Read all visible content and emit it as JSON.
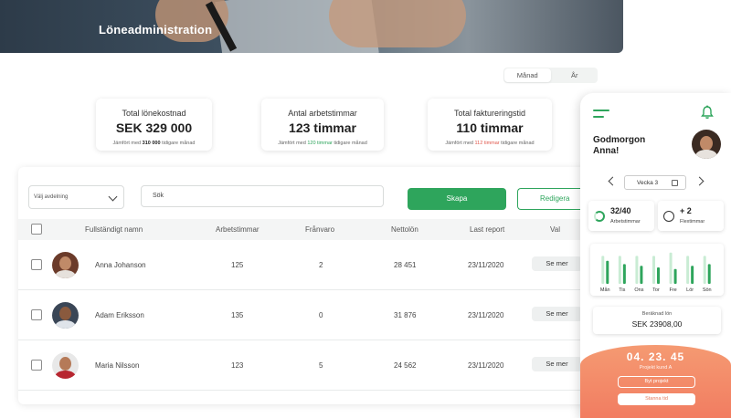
{
  "header": {
    "title": "Löneadministration"
  },
  "period_toggle": {
    "options": [
      "Månad",
      "År"
    ],
    "selected": "Månad"
  },
  "stats": [
    {
      "label": "Total lönekostnad",
      "value": "SEK 329 000",
      "cmp_prefix": "Jämfört med",
      "cmp_value": "310 000",
      "cmp_suffix": "tidigare månad",
      "cmp_color": "dark"
    },
    {
      "label": "Antal arbetstimmar",
      "value": "123 timmar",
      "cmp_prefix": "Jämfört med",
      "cmp_value": "120 timmar",
      "cmp_suffix": "tidigare månad",
      "cmp_color": "green"
    },
    {
      "label": "Total faktureringstid",
      "value": "110 timmar",
      "cmp_prefix": "Jämfört med",
      "cmp_value": "112 timmar",
      "cmp_suffix": "tidigare månad",
      "cmp_color": "red"
    }
  ],
  "toolbar": {
    "department_placeholder": "Välj avdelning",
    "search_placeholder": "Sök",
    "create_label": "Skapa",
    "edit_label": "Redigera"
  },
  "table": {
    "headers": [
      "Fullständigt namn",
      "Arbetstimmar",
      "Frånvaro",
      "Nettolön",
      "Last report",
      "Val"
    ],
    "rows": [
      {
        "name": "Anna Johanson",
        "hours": "125",
        "absence": "2",
        "net": "28 451",
        "report": "23/11/2020",
        "action": "Se mer"
      },
      {
        "name": "Adam Eriksson",
        "hours": "135",
        "absence": "0",
        "net": "31 876",
        "report": "23/11/2020",
        "action": "Se mer"
      },
      {
        "name": "Maria Nilsson",
        "hours": "123",
        "absence": "5",
        "net": "24 562",
        "report": "23/11/2020",
        "action": "Se mer"
      }
    ]
  },
  "phone": {
    "greeting_line1": "Godmorgon",
    "greeting_line2": "Anna!",
    "week_label": "Vecka 3",
    "hours_value": "32/40",
    "hours_label": "Arbetstimmar",
    "flex_value": "+ 2",
    "flex_label": "Flextimmar",
    "chart_data": {
      "type": "bar",
      "categories": [
        "Mån",
        "Tis",
        "Ons",
        "Tor",
        "Fre",
        "Lör",
        "Sön"
      ],
      "series": [
        {
          "values": [
            0.85,
            0.85,
            0.85,
            0.85,
            0.95,
            0.85,
            0.85
          ]
        },
        {
          "values": [
            0.7,
            0.6,
            0.55,
            0.5,
            0.45,
            0.55,
            0.6
          ]
        }
      ],
      "colors": [
        "#c9ecd4",
        "#2ea55c"
      ]
    },
    "salary_label": "Beräknad lön",
    "salary_value": "SEK 23908,00",
    "timer": "04. 23. 45",
    "project": "Projekt kund A",
    "switch_label": "Byt projekt",
    "stop_label": "Stanna tid"
  },
  "colors": {
    "accent": "#2ea55c",
    "timer": "#f1795f"
  }
}
